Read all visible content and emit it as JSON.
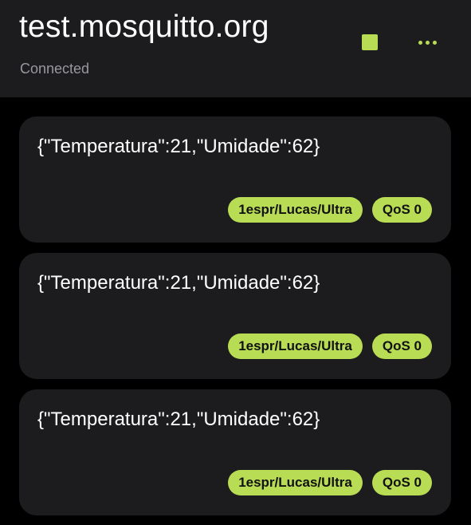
{
  "header": {
    "title": "test.mosquitto.org",
    "status": "Connected",
    "stop_icon": "stop-icon",
    "more_icon": "more-horizontal-icon"
  },
  "colors": {
    "accent": "#b8dc54",
    "background": "#000000",
    "surface": "#1c1c1e",
    "secondary_text": "#98989d"
  },
  "messages": [
    {
      "payload": "{\"Temperatura\":21,\"Umidade\":62}",
      "topic": "1espr/Lucas/Ultra",
      "qos": "QoS 0"
    },
    {
      "payload": "{\"Temperatura\":21,\"Umidade\":62}",
      "topic": "1espr/Lucas/Ultra",
      "qos": "QoS 0"
    },
    {
      "payload": "{\"Temperatura\":21,\"Umidade\":62}",
      "topic": "1espr/Lucas/Ultra",
      "qos": "QoS 0"
    }
  ]
}
